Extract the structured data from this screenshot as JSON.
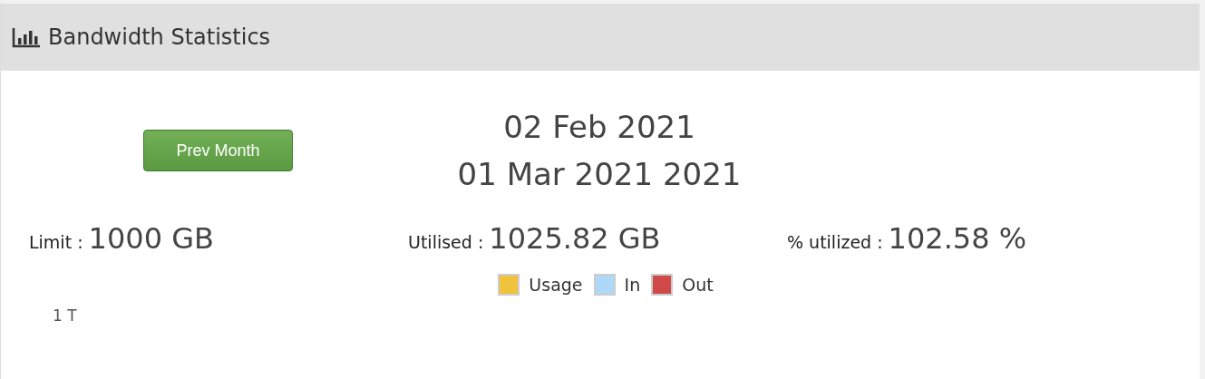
{
  "panel": {
    "title": "Bandwidth Statistics"
  },
  "prev_button": "Prev Month",
  "period": {
    "start": "02 Feb 2021",
    "end": "01 Mar 2021 2021"
  },
  "stats": [
    {
      "label": "Limit :",
      "value": "1000 GB"
    },
    {
      "label": "Utilised :",
      "value": "1025.82 GB"
    },
    {
      "label": "% utilized :",
      "value": "102.58 %"
    }
  ],
  "legend": [
    {
      "label": "Usage",
      "color": "#f0c33c"
    },
    {
      "label": "In",
      "color": "#afd8f8"
    },
    {
      "label": "Out",
      "color": "#d04a4a"
    }
  ],
  "axis_label": "1 T"
}
